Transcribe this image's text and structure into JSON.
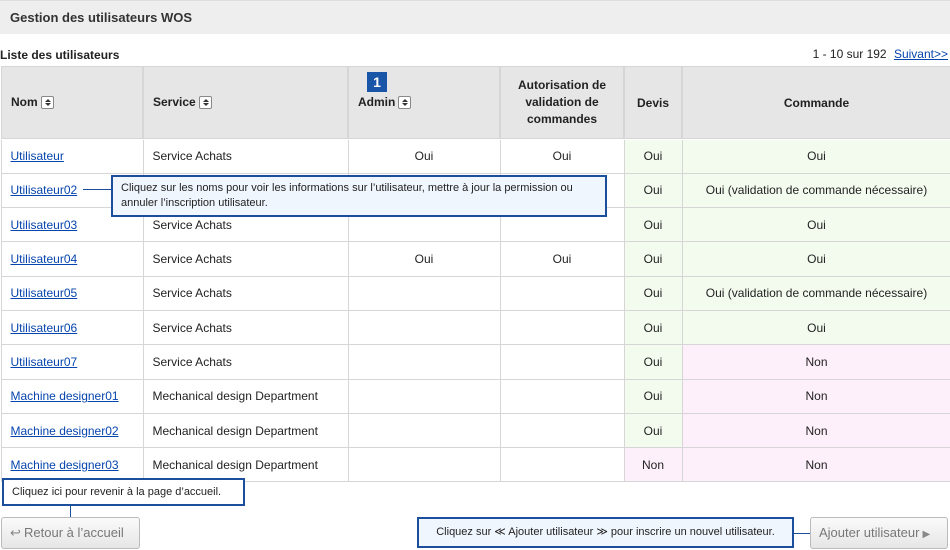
{
  "header": {
    "title": "Gestion des utilisateurs WOS"
  },
  "list": {
    "title": "Liste des utilisateurs",
    "range": "1 - 10 sur 192",
    "next": "Suivant>>"
  },
  "columns": {
    "name": "Nom",
    "service": "Service",
    "admin": "Admin",
    "approval": "Autorisation de validation de commandes",
    "quote": "Devis",
    "order": "Commande"
  },
  "marker": "1",
  "rows": [
    {
      "name": "Utilisateur",
      "service": "Service Achats",
      "admin": "Oui",
      "approval": "Oui",
      "quote": "Oui",
      "order": "Oui"
    },
    {
      "name": "Utilisateur02",
      "service": "",
      "admin": "",
      "approval": "",
      "quote": "Oui",
      "order": "Oui (validation de commande nécessaire)"
    },
    {
      "name": "Utilisateur03",
      "service": "Service Achats",
      "admin": "",
      "approval": "",
      "quote": "Oui",
      "order": "Oui"
    },
    {
      "name": "Utilisateur04",
      "service": "Service Achats",
      "admin": "Oui",
      "approval": "Oui",
      "quote": "Oui",
      "order": "Oui"
    },
    {
      "name": "Utilisateur05",
      "service": "Service Achats",
      "admin": "",
      "approval": "",
      "quote": "Oui",
      "order": "Oui (validation de commande nécessaire)"
    },
    {
      "name": "Utilisateur06",
      "service": "Service Achats",
      "admin": "",
      "approval": "",
      "quote": "Oui",
      "order": "Oui"
    },
    {
      "name": "Utilisateur07",
      "service": "Service Achats",
      "admin": "",
      "approval": "",
      "quote": "Oui",
      "order": "Non"
    },
    {
      "name": "Machine designer01",
      "service": "Mechanical design Department",
      "admin": "",
      "approval": "",
      "quote": "Oui",
      "order": "Non"
    },
    {
      "name": "Machine designer02",
      "service": "Mechanical design Department",
      "admin": "",
      "approval": "",
      "quote": "Oui",
      "order": "Non"
    },
    {
      "name": "Machine designer03",
      "service": "Mechanical design Department",
      "admin": "",
      "approval": "",
      "quote": "Non",
      "order": "Non"
    }
  ],
  "callouts": {
    "names": "Cliquez sur les noms pour voir les informations sur l’utilisateur, mettre à jour la permission ou annuler l’inscription utilisateur.",
    "home": "Cliquez ici pour revenir à la page d’accueil.",
    "add": "Cliquez sur ≪ Ajouter utilisateur ≫ pour inscrire un nouvel utilisateur."
  },
  "buttons": {
    "back": "Retour à l’accueil",
    "add": "Ajouter utilisateur"
  },
  "colors": {
    "accent": "#1b4f9c",
    "link": "#0645ad",
    "ok_bg": "#f3fbef",
    "no_bg": "#fdf0fa"
  }
}
